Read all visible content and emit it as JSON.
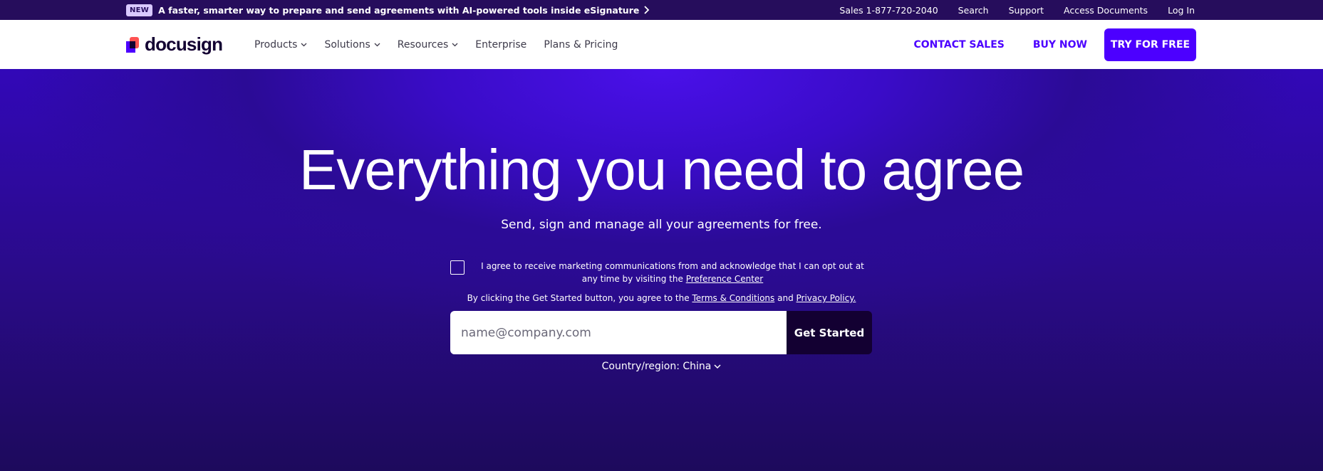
{
  "topbar": {
    "badge": "NEW",
    "announcement": "A faster, smarter way to prepare and send agreements with AI-powered tools inside eSignature",
    "links": {
      "sales": "Sales 1-877-720-2040",
      "search": "Search",
      "support": "Support",
      "access_documents": "Access Documents",
      "log_in": "Log In"
    }
  },
  "nav": {
    "logo_text": "docusign",
    "items": {
      "products": "Products",
      "solutions": "Solutions",
      "resources": "Resources",
      "enterprise": "Enterprise",
      "plans_pricing": "Plans & Pricing"
    },
    "contact_sales": "CONTACT SALES",
    "buy_now": "BUY NOW",
    "try_free": "TRY FOR FREE"
  },
  "hero": {
    "title": "Everything you need to agree",
    "subtitle": "Send, sign and manage all your agreements for free.",
    "consent_text": "I agree to receive marketing communications from and acknowledge that I can opt out at any time by visiting the",
    "preference_center": "Preference Center",
    "terms_prefix": "By clicking the Get Started button, you agree to the",
    "terms_link": "Terms & Conditions",
    "terms_and": "and",
    "privacy_link": "Privacy Policy.",
    "email_placeholder": "name@company.com",
    "get_started": "Get Started",
    "country_label": "Country/region: China"
  },
  "colors": {
    "brand": "#4c00ff",
    "topbar_bg": "#260d5c",
    "dark": "#130032",
    "logo_red": "#ff5252"
  }
}
